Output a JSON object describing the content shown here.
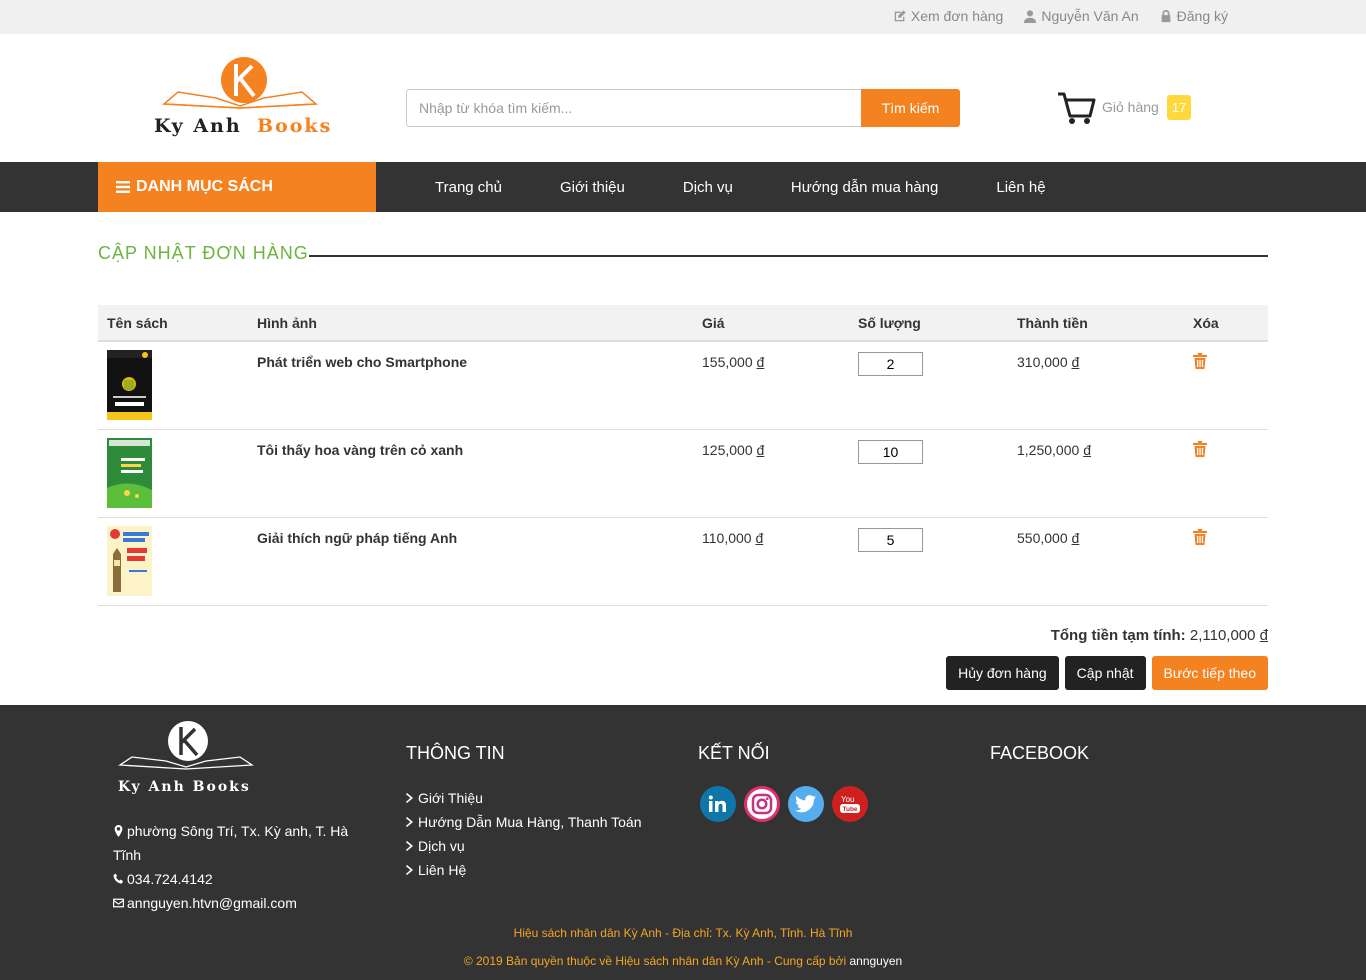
{
  "topbar": {
    "view_orders": "Xem đơn hàng",
    "user_name": "Nguyễn Văn An",
    "register": "Đăng ký"
  },
  "header": {
    "logo_text_1": "Ky Anh",
    "logo_text_2": "Books",
    "search_placeholder": "Nhập từ khóa tìm kiếm...",
    "search_button": "Tìm kiếm",
    "cart_label": "Giỏ hàng",
    "cart_count": "17"
  },
  "nav": {
    "category_button": "DANH MỤC SÁCH",
    "links": [
      "Trang chủ",
      "Giới thiệu",
      "Dịch vụ",
      "Hướng dẫn mua hàng",
      "Liên hệ"
    ]
  },
  "section_title": "CẬP NHẬT ĐƠN HÀNG",
  "table": {
    "headers": [
      "Tên sách",
      "Hình ảnh",
      "Giá",
      "Số lượng",
      "Thành tiền",
      "Xóa"
    ],
    "currency": "đ",
    "rows": [
      {
        "title": "Phát triển web cho Smartphone",
        "price": "155,000",
        "qty": "2",
        "total": "310,000",
        "cover": "smartphone"
      },
      {
        "title": "Tôi thấy hoa vàng trên cỏ xanh",
        "price": "125,000",
        "qty": "10",
        "total": "1,250,000",
        "cover": "hoavang"
      },
      {
        "title": "Giải thích ngữ pháp tiếng Anh",
        "price": "110,000",
        "qty": "5",
        "total": "550,000",
        "cover": "tienganh"
      }
    ]
  },
  "summary": {
    "label": "Tổng tiền tạm tính:",
    "value": "2,110,000",
    "currency": "đ"
  },
  "actions": {
    "cancel": "Hủy đơn hàng",
    "update": "Cập nhật",
    "next": "Bước tiếp theo"
  },
  "footer": {
    "logo_text": "Ky Anh Books",
    "address": "phường Sông Trí, Tx. Kỳ anh, T. Hà Tĩnh",
    "phone": "034.724.4142",
    "email": "annguyen.htvn@gmail.com",
    "info_title": "THÔNG TIN",
    "info_links": [
      "Giới Thiệu",
      "Hướng Dẫn Mua Hàng, Thanh Toán",
      "Dịch vụ",
      "Liên Hệ"
    ],
    "connect_title": "KẾT NỐI",
    "social": [
      "linkedin-icon",
      "instagram-icon",
      "twitter-icon",
      "youtube-icon"
    ],
    "facebook_title": "FACEBOOK",
    "bottom_line_1": "Hiệu sách nhân dân Kỳ Anh - Địa chỉ: Tx. Kỳ Anh, Tỉnh. Hà Tĩnh",
    "bottom_line_2": "© 2019 Bản quyền thuộc về Hiệu sách nhân dân Kỳ Anh - Cung cấp bởi",
    "bottom_author": "annguyen"
  },
  "colors": {
    "accent": "#f58220",
    "dark": "#333333",
    "title_green": "#6db33f",
    "badge_yellow": "#ffd83b"
  }
}
